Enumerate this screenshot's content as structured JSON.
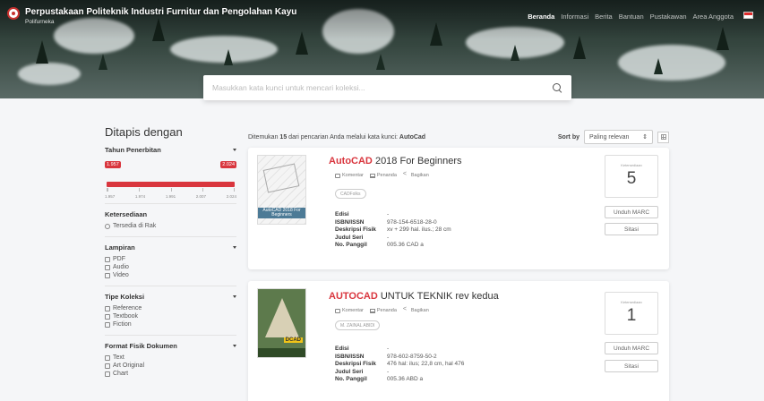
{
  "header": {
    "title": "Perpustakaan Politeknik Industri Furnitur dan Pengolahan Kayu",
    "subtitle": "Polifurneka",
    "nav": [
      "Beranda",
      "Informasi",
      "Berita",
      "Bantuan",
      "Pustakawan",
      "Area Anggota"
    ]
  },
  "search": {
    "placeholder": "Masukkan kata kunci untuk mencari koleksi...",
    "value": ""
  },
  "sidebar": {
    "title": "Ditapis dengan",
    "year": {
      "label": "Tahun Penerbitan",
      "min_label": "1.957",
      "max_label": "2.024",
      "ticks": [
        "1.957",
        "1.974",
        "1.991",
        "2.007",
        "2.024"
      ]
    },
    "availability": {
      "label": "Ketersediaan",
      "options": [
        "Tersedia di Rak"
      ]
    },
    "attachment": {
      "label": "Lampiran",
      "options": [
        "PDF",
        "Audio",
        "Video"
      ]
    },
    "collection_type": {
      "label": "Tipe Koleksi",
      "options": [
        "Reference",
        "Textbook",
        "Fiction"
      ]
    },
    "physical_format": {
      "label": "Format Fisik Dokumen",
      "options": [
        "Text",
        "Art Original",
        "Chart"
      ]
    }
  },
  "results": {
    "summary_prefix": "Ditemukan",
    "count": "15",
    "summary_mid": "dari pencarian Anda melalui kata kunci:",
    "keyword": "AutoCad",
    "sort_label": "Sort by",
    "sort_value": "Paling relevan",
    "items": [
      {
        "title_highlight": "AutoCAD",
        "title_rest": " 2018 For Beginners",
        "cover_text": "AutoCAD 2018 For Beginners",
        "author": "CADFolks",
        "actions": [
          "Komentar",
          "Penanda",
          "Bagikan"
        ],
        "meta": [
          {
            "k": "Edisi",
            "v": "-"
          },
          {
            "k": "ISBN/ISSN",
            "v": "978-154-6518-28-0"
          },
          {
            "k": "Deskripsi Fisik",
            "v": "xv + 299 hal. ilus.; 28 cm"
          },
          {
            "k": "Judul Seri",
            "v": "-"
          },
          {
            "k": "No. Panggil",
            "v": "005.36 CAD a"
          }
        ],
        "availability_label": "Ketersediaan",
        "availability": "5",
        "btn_marc": "Unduh MARC",
        "btn_cite": "Sitasi"
      },
      {
        "title_highlight": "AUTOCAD",
        "title_rest": " UNTUK TEKNIK rev kedua",
        "cover_text": "DCAD",
        "author": "M. ZAINAL ABIDI",
        "actions": [
          "Komentar",
          "Penanda",
          "Bagikan"
        ],
        "meta": [
          {
            "k": "Edisi",
            "v": "-"
          },
          {
            "k": "ISBN/ISSN",
            "v": "978-602-8759-50-2"
          },
          {
            "k": "Deskripsi Fisik",
            "v": "476 hal: ilus; 22,8 cm, hal 476"
          },
          {
            "k": "Judul Seri",
            "v": "-"
          },
          {
            "k": "No. Panggil",
            "v": "005.36 ABD a"
          }
        ],
        "availability_label": "Ketersediaan",
        "availability": "1",
        "btn_marc": "Unduh MARC",
        "btn_cite": "Sitasi"
      }
    ]
  },
  "colors": {
    "accent": "#d9363e",
    "header_bg": "#2c3a34"
  }
}
